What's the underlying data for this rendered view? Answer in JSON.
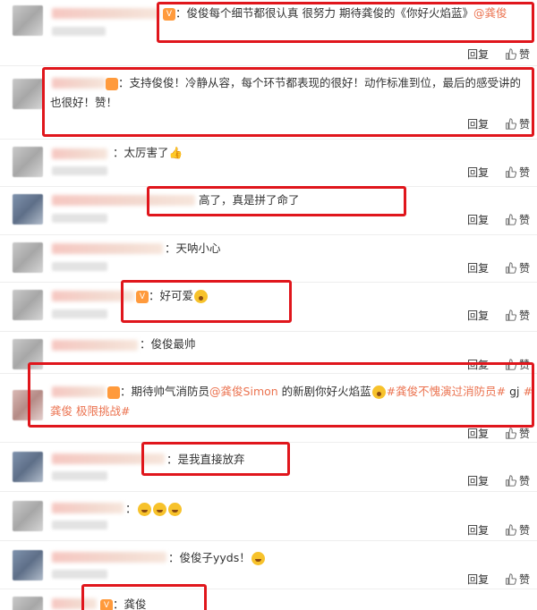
{
  "actions": {
    "reply": "回复",
    "like": "赞"
  },
  "comments": [
    {
      "text_a": "俊俊每个细节都很认真 很努力 期待龚俊的《你好火焰蓝》",
      "mention": "@龚俊"
    },
    {
      "text": "支持俊俊！冷静从容，每个环节都表现的很好！动作标准到位，最后的感受讲的也很好！赞！"
    },
    {
      "text": "太厉害了"
    },
    {
      "text": "高了，真是拼了命了"
    },
    {
      "text": "天呐小心"
    },
    {
      "text": "好可爱"
    },
    {
      "text": "俊俊最帅"
    },
    {
      "text_a": "期待帅气消防员",
      "mention": "@龚俊Simon",
      "text_b": " 的新剧你好火焰蓝",
      "tag1": "#龚俊不愧演过消防员#",
      "text_c": " gj ",
      "tag2": "#龚俊 极限挑战#"
    },
    {
      "text": "是我直接放弃"
    },
    {
      "text": ""
    },
    {
      "text": "俊俊子yyds！"
    },
    {
      "text": "龚俊"
    }
  ]
}
